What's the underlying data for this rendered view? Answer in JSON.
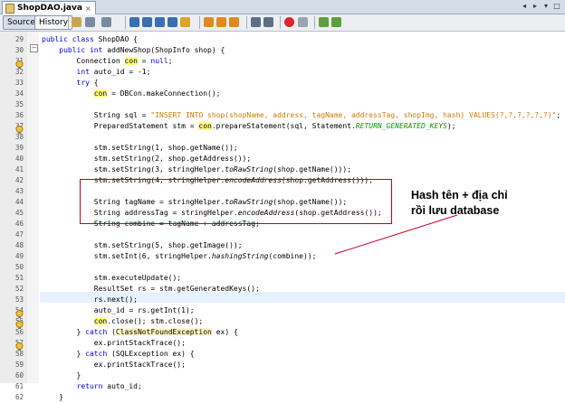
{
  "tab": {
    "title": "ShopDAO.java",
    "close_glyph": "×",
    "nav_left": "◂",
    "nav_right": "▸",
    "nav_menu": "▾",
    "nav_restore": "□"
  },
  "toolbar": {
    "source_label": "Source",
    "history_label": "History"
  },
  "lines": [
    {
      "num": "29",
      "html": "<span class=\"kw\">public class</span> ShopDAO {"
    },
    {
      "num": "30",
      "html": "    <span class=\"kw\">public int</span> addNewShop(ShopInfo shop) {"
    },
    {
      "num": "31",
      "html": "        Connection <span class=\"hl\">con</span> = <span class=\"kw\">null</span>;"
    },
    {
      "num": "32",
      "html": "        <span class=\"kw\">int</span> auto_id = -1;"
    },
    {
      "num": "33",
      "html": "        <span class=\"kw\">try</span> {"
    },
    {
      "num": "34",
      "html": "            <span class=\"hl\">con</span> = DBCon.makeConnection();"
    },
    {
      "num": "35",
      "html": ""
    },
    {
      "num": "36",
      "html": "            String sql = <span class=\"str\">\"INSERT INTO shop(shopName, address, tagName, addressTag, shopImg, hash) VALUES(?,?,?,?,?,?)\"</span>;"
    },
    {
      "num": "37",
      "html": "            PreparedStatement stm = <span class=\"hl\">con</span>.prepareStatement(sql, Statement.<span class=\"fld\">RETURN_GENERATED_KEYS</span>);"
    },
    {
      "num": "38",
      "html": ""
    },
    {
      "num": "39",
      "html": "            stm.setString(1, shop.getName());"
    },
    {
      "num": "40",
      "html": "            stm.setString(2, shop.getAddress());"
    },
    {
      "num": "41",
      "html": "            stm.setString(3, stringHelper.<span class=\"itl\">toRawString</span>(shop.getName()));"
    },
    {
      "num": "42",
      "html": "            stm.setString(4, stringHelper.<span class=\"itl\">encodeAddress</span>(shop.getAddress()));"
    },
    {
      "num": "43",
      "html": ""
    },
    {
      "num": "44",
      "html": "            String tagName = stringHelper.<span class=\"itl\">toRawString</span>(shop.getName());"
    },
    {
      "num": "45",
      "html": "            String addressTag = stringHelper.<span class=\"itl\">encodeAddress</span>(shop.getAddress());"
    },
    {
      "num": "46",
      "html": "            String combine = tagName + addressTag;"
    },
    {
      "num": "47",
      "html": ""
    },
    {
      "num": "48",
      "html": "            stm.setString(5, shop.getImage());"
    },
    {
      "num": "49",
      "html": "            stm.setInt(6, stringHelper.<span class=\"itl\">hashingString</span>(combine));"
    },
    {
      "num": "50",
      "html": ""
    },
    {
      "num": "51",
      "html": "            stm.executeUpdate();"
    },
    {
      "num": "52",
      "html": "            ResultSet rs = stm.getGeneratedKeys();"
    },
    {
      "num": "53",
      "html": "            rs.next();"
    },
    {
      "num": "54",
      "html": "            auto_id = rs.getInt(1);"
    },
    {
      "num": "55",
      "html": "            <span class=\"hl\">con</span>.close(); stm.close();"
    },
    {
      "num": "56",
      "html": "        } <span class=\"kw\">catch</span> (<span class=\"cls\">ClassNotFoundException</span> ex) {"
    },
    {
      "num": "57",
      "html": "            ex.printStackTrace();"
    },
    {
      "num": "58",
      "html": "        } <span class=\"kw\">catch</span> (SQLException ex) {"
    },
    {
      "num": "59",
      "html": "            ex.printStackTrace();"
    },
    {
      "num": "60",
      "html": "        }"
    },
    {
      "num": "61",
      "html": "        <span class=\"kw\">return</span> auto_id;"
    },
    {
      "num": "62",
      "html": "    }"
    }
  ],
  "annotation": {
    "text": "Hash tên + địa chỉ\nrồi lưu database"
  },
  "colors": {
    "annotation_box": "#c0001e",
    "keyword": "#0000e6",
    "string": "#ce7b00",
    "highlight": "#ffff80"
  }
}
